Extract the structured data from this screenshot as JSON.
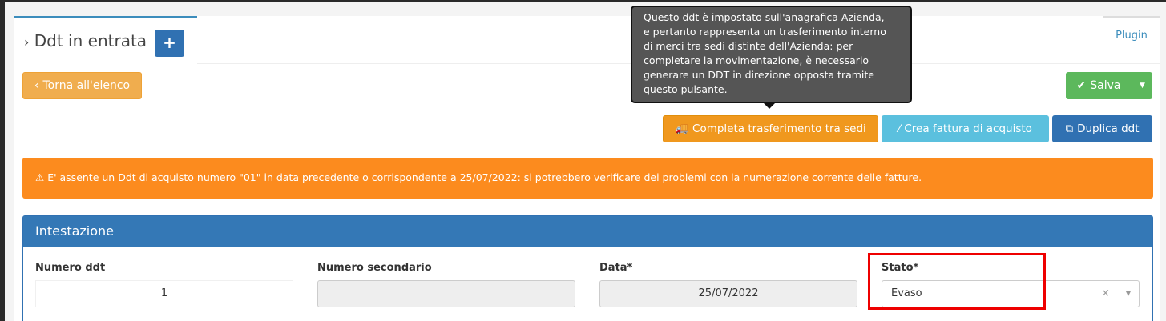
{
  "header": {
    "title": "Ddt in entrata",
    "add_label": "+",
    "plugin_tab": "Plugin"
  },
  "toolbar": {
    "back_label": "Torna all'elenco",
    "save_label": "Salva",
    "complete_transfer_label": "Completa trasferimento tra sedi",
    "create_invoice_label": "Crea fattura di acquisto",
    "duplicate_label": "Duplica ddt"
  },
  "tooltip": {
    "lines": [
      "Questo ddt è impostato sull'anagrafica Azienda,",
      "e pertanto rappresenta un trasferimento interno",
      "di merci tra sedi distinte dell'Azienda: per",
      "completare la movimentazione, è necessario",
      "generare un DDT in direzione opposta tramite",
      "questo pulsante."
    ]
  },
  "alert": {
    "text": "E' assente un Ddt di acquisto numero \"01\" in data precedente o corrispondente a 25/07/2022: si potrebbero verificare dei problemi con la numerazione corrente delle fatture."
  },
  "panel": {
    "title": "Intestazione",
    "fields": [
      {
        "label": "Numero ddt",
        "value": "1"
      },
      {
        "label": "Numero secondario",
        "value": ""
      },
      {
        "label": "Data*",
        "value": "25/07/2022"
      },
      {
        "label": "Stato*",
        "value": "Evaso"
      }
    ]
  },
  "colors": {
    "primary": "#3071b2",
    "warning": "#f0ad4e",
    "success": "#5cb85c",
    "info": "#5bc0de",
    "alert": "#fc8b1e",
    "highlight": "#e00000"
  }
}
